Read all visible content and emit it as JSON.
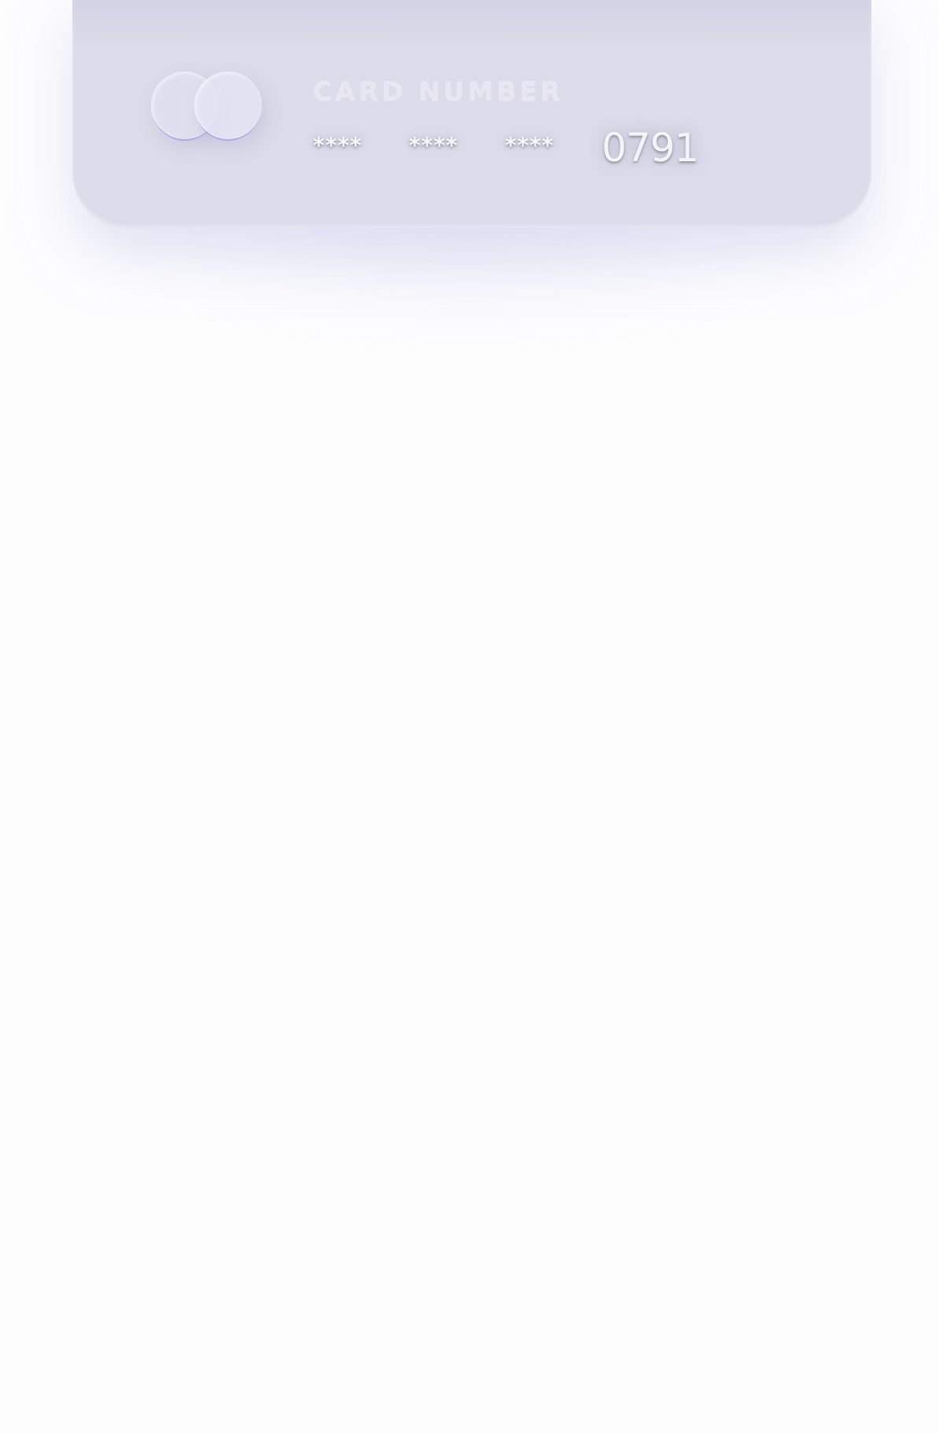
{
  "card": {
    "label": "CARD NUMBER",
    "number_groups": [
      "****",
      "****",
      "****",
      "0791"
    ],
    "colors": {
      "card_background": "#dcdbe9",
      "logo_ring_accent": "#968ceb",
      "page_background": "#fdfdfe"
    },
    "logo_icon": "two-overlapping-circles"
  }
}
